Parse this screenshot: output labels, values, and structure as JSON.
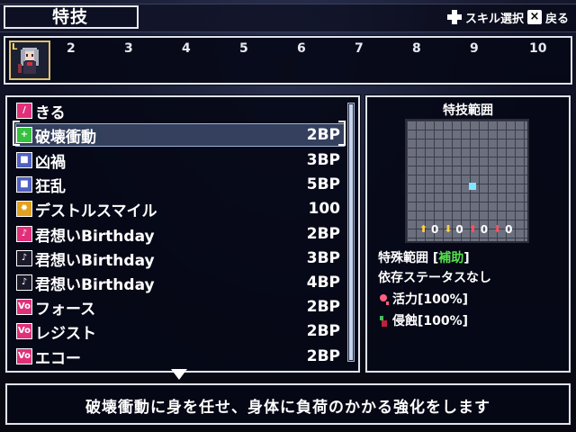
{
  "header": {
    "title": "特技",
    "hint_select": "スキル選択",
    "hint_back": "戻る",
    "hint_select_icon": "dpad-icon",
    "hint_back_icon": "x-button-icon"
  },
  "party": {
    "active_badge": "L",
    "slots": [
      "2",
      "3",
      "4",
      "5",
      "6",
      "7",
      "8",
      "9",
      "10"
    ]
  },
  "skills": [
    {
      "name": "きる",
      "cost": "",
      "icon": "slash-icon",
      "icon_color": "#e0307a"
    },
    {
      "name": "破壊衝動",
      "cost": "2BP",
      "icon": "plus-icon",
      "icon_color": "#38c040"
    },
    {
      "name": "凶禍",
      "cost": "3BP",
      "icon": "square-icon",
      "icon_color": "#d040b0"
    },
    {
      "name": "狂乱",
      "cost": "5BP",
      "icon": "square-icon",
      "icon_color": "#d040b0"
    },
    {
      "name": "デストルスマイル",
      "cost": "100",
      "icon": "sun-icon",
      "icon_color": "#e0a020"
    },
    {
      "name": "君想いBirthday",
      "cost": "2BP",
      "icon": "note-icon",
      "icon_color": "#e0307a"
    },
    {
      "name": "君想いBirthday",
      "cost": "3BP",
      "icon": "note-icon",
      "icon_color": "#e0307a"
    },
    {
      "name": "君想いBirthday",
      "cost": "4BP",
      "icon": "note-icon",
      "icon_color": "#e0307a"
    },
    {
      "name": "フォース",
      "cost": "2BP",
      "icon": "vo-icon",
      "icon_color": "#e0307a"
    },
    {
      "name": "レジスト",
      "cost": "2BP",
      "icon": "vo-icon",
      "icon_color": "#e0307a"
    },
    {
      "name": "エコー",
      "cost": "2BP",
      "icon": "vo-icon",
      "icon_color": "#e0307a"
    }
  ],
  "selected_index": 1,
  "range_panel": {
    "title": "特技範囲",
    "buffs": [
      "0",
      "0",
      "0",
      "0"
    ],
    "special_range_label": "特殊範囲 [",
    "special_range_value": "補助",
    "special_range_close": "]",
    "dependency": "依存ステータスなし",
    "effect1": "活力[100%]",
    "effect2": "侵蝕[100%]"
  },
  "description": "破壊衝動に身を任せ、身体に負荷のかかる強化をします"
}
